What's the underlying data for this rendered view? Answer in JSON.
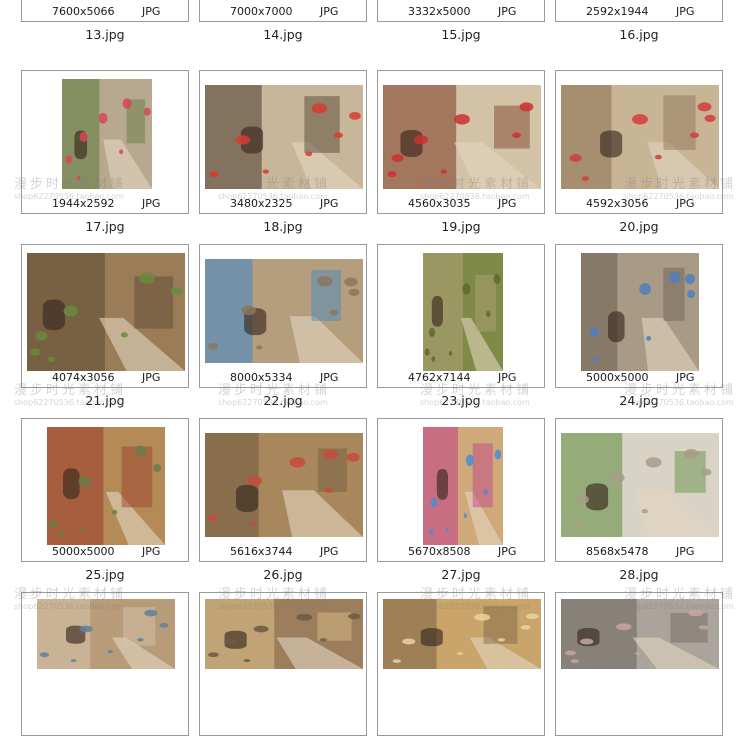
{
  "watermark": {
    "text": "漫步时光素材铺",
    "shop": "shop62270536.taobao.com"
  },
  "items": [
    {
      "file": "13.jpg",
      "dims": "7600x5066",
      "format": "JPG",
      "palette": [
        "#5e6e74",
        "#3d4a50",
        "#8a8d86"
      ]
    },
    {
      "file": "14.jpg",
      "dims": "7000x7000",
      "format": "JPG",
      "palette": [
        "#c9b48e",
        "#8a6a45",
        "#e7d9bd"
      ]
    },
    {
      "file": "15.jpg",
      "dims": "3332x5000",
      "format": "JPG",
      "palette": [
        "#4e3c33",
        "#2a211c",
        "#7c6453"
      ]
    },
    {
      "file": "16.jpg",
      "dims": "2592x1944",
      "format": "JPG",
      "palette": [
        "#cdbca3",
        "#a9846a",
        "#c23d3d"
      ]
    },
    {
      "file": "17.jpg",
      "dims": "1944x2592",
      "format": "JPG",
      "palette": [
        "#b7a88f",
        "#5d7a3a",
        "#d9445a"
      ]
    },
    {
      "file": "18.jpg",
      "dims": "3480x2325",
      "format": "JPG",
      "palette": [
        "#c8b69a",
        "#4a3a2d",
        "#d9392f"
      ]
    },
    {
      "file": "19.jpg",
      "dims": "4560x3035",
      "format": "JPG",
      "palette": [
        "#d2c2a6",
        "#7b3a22",
        "#cf2f2f"
      ]
    },
    {
      "file": "20.jpg",
      "dims": "4592x3056",
      "format": "JPG",
      "palette": [
        "#c7b596",
        "#8a6d52",
        "#d23c3c"
      ]
    },
    {
      "file": "21.jpg",
      "dims": "4074x3056",
      "format": "JPG",
      "palette": [
        "#9a7d57",
        "#5d4832",
        "#6a8a3e"
      ]
    },
    {
      "file": "22.jpg",
      "dims": "8000x5334",
      "format": "JPG",
      "palette": [
        "#b59e7e",
        "#3d88c8",
        "#8c7559"
      ]
    },
    {
      "file": "23.jpg",
      "dims": "4762x7144",
      "format": "JPG",
      "palette": [
        "#7e8a45",
        "#b3a27c",
        "#5a6b2e"
      ]
    },
    {
      "file": "24.jpg",
      "dims": "5000x5000",
      "format": "JPG",
      "palette": [
        "#a89a84",
        "#6a5f52",
        "#4d7fbf"
      ]
    },
    {
      "file": "25.jpg",
      "dims": "5000x5000",
      "format": "JPG",
      "palette": [
        "#b48a57",
        "#9c3a2a",
        "#6a7c4a"
      ]
    },
    {
      "file": "26.jpg",
      "dims": "5616x3744",
      "format": "JPG",
      "palette": [
        "#a8875d",
        "#6d5a3e",
        "#c94a3c"
      ]
    },
    {
      "file": "27.jpg",
      "dims": "5670x8508",
      "format": "JPG",
      "palette": [
        "#d0a97a",
        "#c23c8a",
        "#4d8ccf"
      ]
    },
    {
      "file": "28.jpg",
      "dims": "8568x5478",
      "format": "JPG",
      "palette": [
        "#d9d3c6",
        "#5c8a3c",
        "#a89c8a"
      ]
    },
    {
      "file": "",
      "dims": "",
      "format": "",
      "palette": [
        "#b89b78",
        "#d8c7ad",
        "#5f7f9e"
      ]
    },
    {
      "file": "",
      "dims": "",
      "format": "",
      "palette": [
        "#9c7e5c",
        "#e0c38a",
        "#6d5a45"
      ]
    },
    {
      "file": "",
      "dims": "",
      "format": "",
      "palette": [
        "#c9a56b",
        "#7b6245",
        "#ead3a0"
      ]
    },
    {
      "file": "",
      "dims": "",
      "format": "",
      "palette": [
        "#a9a49c",
        "#6c655d",
        "#c6a7a0"
      ]
    }
  ]
}
